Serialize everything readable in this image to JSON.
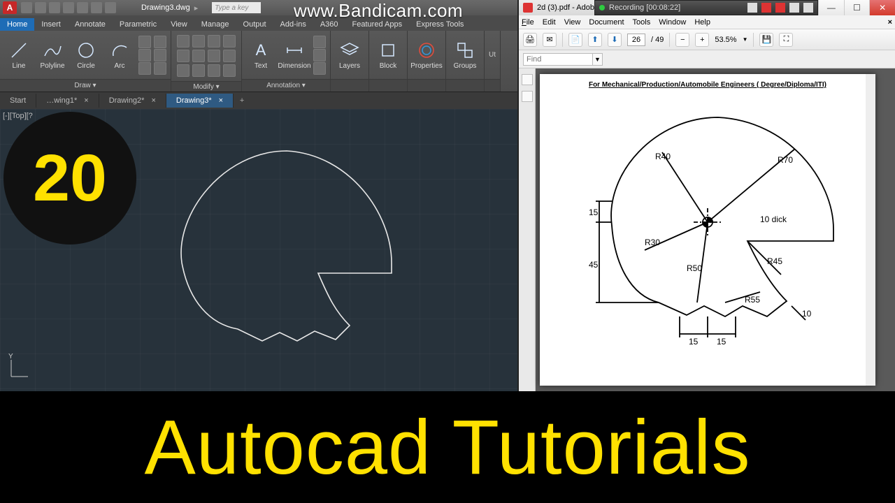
{
  "bandicam": {
    "url": "www.Bandicam.com",
    "label": "Recording [00:08:22]"
  },
  "overlay": {
    "badge": "20",
    "banner": "Autocad Tutorials"
  },
  "acad": {
    "title_doc": "Drawing3.dwg",
    "search_placeholder": "Type a key",
    "tabs": [
      "Home",
      "Insert",
      "Annotate",
      "Parametric",
      "View",
      "Manage",
      "Output",
      "Add-ins",
      "A360",
      "Featured Apps",
      "Express Tools"
    ],
    "active_tab": "Home",
    "panels": {
      "draw": {
        "label": "Draw ▾",
        "items": [
          "Line",
          "Polyline",
          "Circle",
          "Arc"
        ]
      },
      "modify": {
        "label": "Modify ▾"
      },
      "annotation": {
        "label": "Annotation ▾",
        "items": [
          "Text",
          "Dimension"
        ]
      },
      "layers": "Layers",
      "block": "Block",
      "properties": "Properties",
      "groups": "Groups",
      "util": "Ut"
    },
    "doc_tabs": [
      "Start",
      "…wing1*",
      "Drawing2*",
      "Drawing3*"
    ],
    "active_doc": "Drawing3*",
    "view_label": "[-][Top][?",
    "ucs_y": "Y"
  },
  "reader": {
    "title": "2d (3).pdf - Adob…",
    "menu": [
      "File",
      "Edit",
      "View",
      "Document",
      "Tools",
      "Window",
      "Help"
    ],
    "page_current": "26",
    "page_total": "/ 49",
    "zoom": "53.5%",
    "find_placeholder": "Find",
    "doc_title": "For Mechanical/Production/Automobile Engineers ( Degree/Diploma/ITI)",
    "dims": {
      "r40": "R40",
      "r70": "R70",
      "r30": "R30",
      "r50": "R50",
      "r45": "R45",
      "r55": "R55",
      "d15a": "15",
      "d45": "45",
      "d15b": "15",
      "d15c": "15",
      "d10": "10",
      "thick": "10  dick"
    }
  }
}
